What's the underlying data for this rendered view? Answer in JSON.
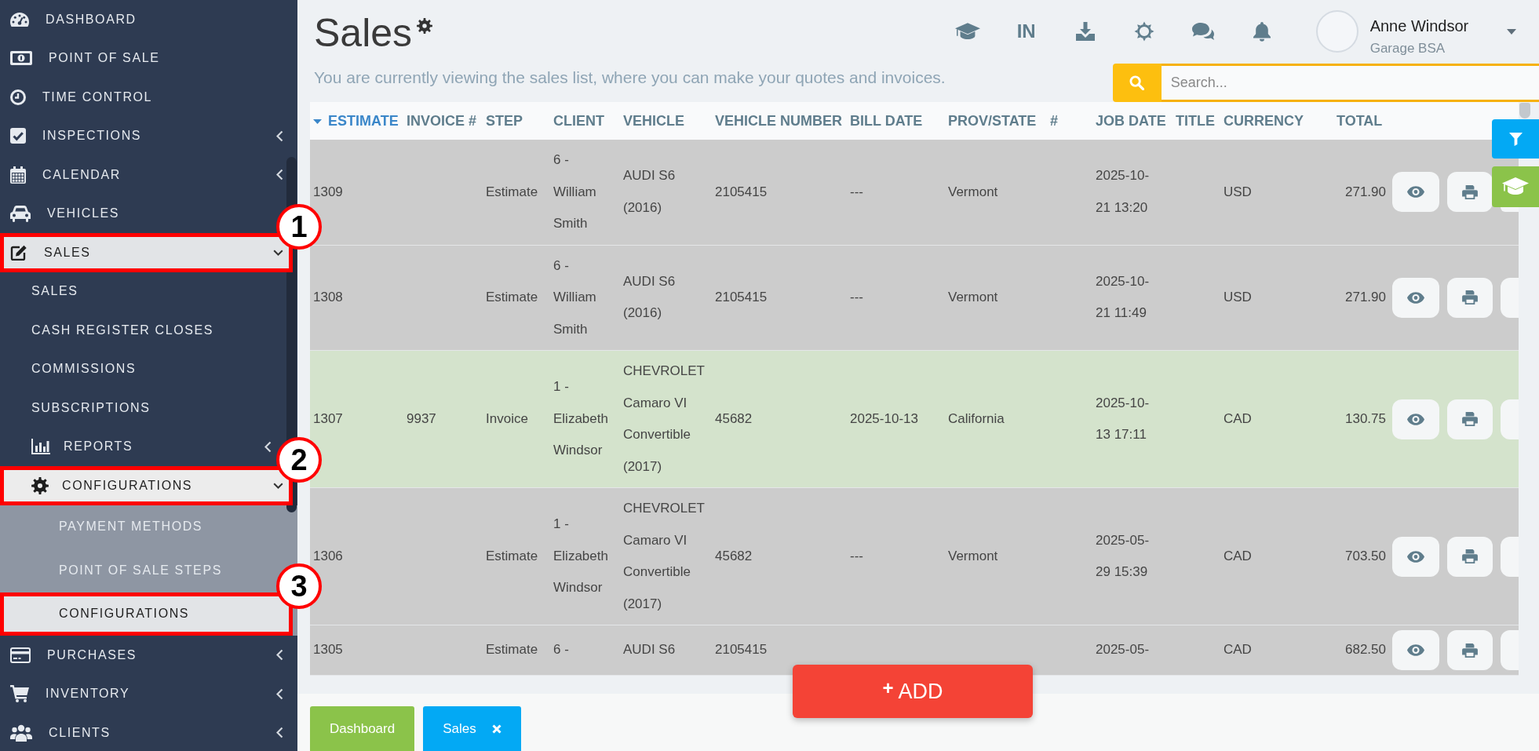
{
  "sidebar": {
    "items": [
      {
        "label": "DASHBOARD",
        "selected": false
      },
      {
        "label": "POINT OF SALE",
        "selected": false
      },
      {
        "label": "TIME CONTROL",
        "selected": false
      },
      {
        "label": "INSPECTIONS",
        "selected": false,
        "expanded": false
      },
      {
        "label": "CALENDAR",
        "selected": false,
        "expanded": false
      },
      {
        "label": "VEHICLES",
        "selected": false
      },
      {
        "label": "SALES",
        "selected": true,
        "expanded": true,
        "callout": "1",
        "children": [
          {
            "label": "SALES",
            "selected": false
          },
          {
            "label": "CASH REGISTER CLOSES",
            "selected": false
          },
          {
            "label": "COMMISSIONS",
            "selected": false
          },
          {
            "label": "SUBSCRIPTIONS",
            "selected": false
          },
          {
            "label": "REPORTS",
            "selected": false,
            "expanded": false
          },
          {
            "label": "CONFIGURATIONS",
            "selected": true,
            "expanded": true,
            "callout": "2",
            "children": [
              {
                "label": "PAYMENT METHODS",
                "selected": false
              },
              {
                "label": "POINT OF SALE STEPS",
                "selected": false
              },
              {
                "label": "CONFIGURATIONS",
                "selected": true,
                "callout": "3"
              }
            ]
          }
        ]
      },
      {
        "label": "PURCHASES",
        "selected": false,
        "expanded": false
      },
      {
        "label": "INVENTORY",
        "selected": false,
        "expanded": false
      },
      {
        "label": "CLIENTS",
        "selected": false,
        "expanded": false
      }
    ]
  },
  "header": {
    "title": "Sales",
    "subtitle": "You are currently viewing the sales list, where you can make your quotes and invoices."
  },
  "toolbar": {
    "language": "IN"
  },
  "user": {
    "name": "Anne Windsor",
    "company": "Garage BSA"
  },
  "search": {
    "placeholder": "Search..."
  },
  "table": {
    "columns": [
      {
        "label": "ESTIMATE",
        "sorted": true
      },
      {
        "label": "INVOICE #",
        "sorted": false
      },
      {
        "label": "STEP",
        "sorted": false
      },
      {
        "label": "CLIENT",
        "sorted": false
      },
      {
        "label": "VEHICLE",
        "sorted": false
      },
      {
        "label": "VEHICLE NUMBER",
        "sorted": false
      },
      {
        "label": "BILL DATE",
        "sorted": false
      },
      {
        "label": "PROV/STATE",
        "sorted": false
      },
      {
        "label": "#",
        "sorted": false
      },
      {
        "label": "JOB DATE",
        "sorted": false
      },
      {
        "label": "TITLE",
        "sorted": false
      },
      {
        "label": "CURRENCY",
        "sorted": false
      },
      {
        "label": "TOTAL",
        "sorted": false
      }
    ],
    "rows": [
      {
        "color": "#cccccc",
        "estimate": "1309",
        "step": "Estimate",
        "client": "6 - William Smith",
        "vehicle": "AUDI S6 (2016)",
        "vehicle_number": "2105415",
        "bill_date": "---",
        "prov_state": "Vermont",
        "job_date": "2025-10-21 13:20",
        "currency": "USD",
        "total": "271.90"
      },
      {
        "color": "#cccccc",
        "estimate": "1308",
        "step": "Estimate",
        "client": "6 - William Smith",
        "vehicle": "AUDI S6 (2016)",
        "vehicle_number": "2105415",
        "bill_date": "---",
        "prov_state": "Vermont",
        "job_date": "2025-10-21 11:49",
        "currency": "USD",
        "total": "271.90"
      },
      {
        "color": "#d4e3cc",
        "estimate": "1307",
        "invoice": "9937",
        "step": "Invoice",
        "client": "1 - Elizabeth Windsor",
        "vehicle": "CHEVROLET Camaro VI Convertible (2017)",
        "vehicle_number": "45682",
        "bill_date": "2025-10-13",
        "prov_state": "California",
        "job_date": "2025-10-13 17:11",
        "currency": "CAD",
        "total": "130.75"
      },
      {
        "color": "#cccccc",
        "estimate": "1306",
        "step": "Estimate",
        "client": "1 - Elizabeth Windsor",
        "vehicle": "CHEVROLET Camaro VI Convertible (2017)",
        "vehicle_number": "45682",
        "bill_date": "---",
        "prov_state": "Vermont",
        "job_date": "2025-05-29 15:39",
        "currency": "CAD",
        "total": "703.50"
      },
      {
        "color": "#cccccc",
        "estimate": "1305",
        "step": "Estimate",
        "client": "6 -",
        "vehicle": "AUDI S6",
        "vehicle_number": "2105415",
        "job_date": "2025-05-",
        "currency": "CAD",
        "total": "682.50"
      }
    ]
  },
  "add_button": {
    "symbol": "+",
    "label": "ADD"
  },
  "tabs": [
    {
      "label": "Dashboard",
      "color": "#8bc34a",
      "closable": false
    },
    {
      "label": "Sales",
      "color": "#03a9f4",
      "closable": true
    }
  ]
}
